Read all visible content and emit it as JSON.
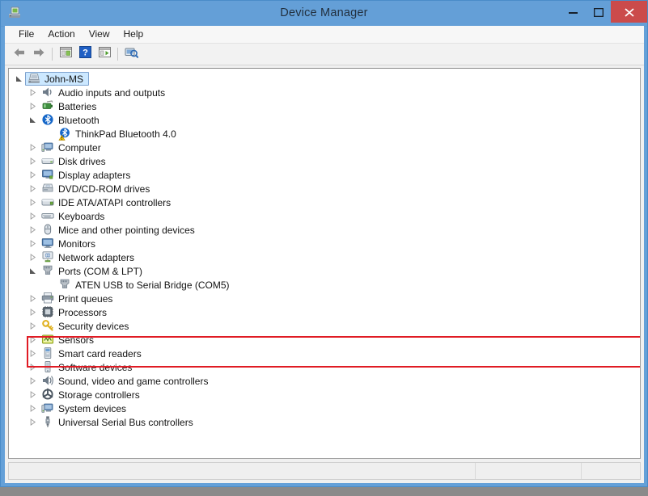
{
  "window": {
    "title": "Device Manager",
    "title_icon": "device-manager-icon",
    "controls": {
      "minimize": "minimize-button",
      "maximize": "maximize-button",
      "close": "close-button"
    },
    "accent_color": "#649fd7",
    "close_color": "#cb4b4b"
  },
  "menubar": {
    "items": [
      {
        "label": "File"
      },
      {
        "label": "Action"
      },
      {
        "label": "View"
      },
      {
        "label": "Help"
      }
    ]
  },
  "toolbar": {
    "buttons": [
      {
        "name": "back-icon",
        "type": "icon"
      },
      {
        "name": "forward-icon",
        "type": "icon"
      },
      {
        "name": "separator",
        "type": "separator"
      },
      {
        "name": "properties-icon",
        "type": "icon"
      },
      {
        "name": "help-icon",
        "type": "icon"
      },
      {
        "name": "update-driver-icon",
        "type": "icon"
      },
      {
        "name": "separator",
        "type": "separator"
      },
      {
        "name": "scan-hardware-changes-icon",
        "type": "icon"
      }
    ]
  },
  "tree": {
    "nodes": [
      {
        "label": "John-MS",
        "level": 0,
        "state": "expanded",
        "icon": "computer-root-icon",
        "selected": true
      },
      {
        "label": "Audio inputs and outputs",
        "level": 1,
        "state": "collapsed",
        "icon": "audio-icon"
      },
      {
        "label": "Batteries",
        "level": 1,
        "state": "collapsed",
        "icon": "battery-icon"
      },
      {
        "label": "Bluetooth",
        "level": 1,
        "state": "expanded",
        "icon": "bluetooth-icon"
      },
      {
        "label": "ThinkPad Bluetooth 4.0",
        "level": 2,
        "state": "leaf",
        "icon": "bluetooth-device-icon",
        "warning": true
      },
      {
        "label": "Computer",
        "level": 1,
        "state": "collapsed",
        "icon": "computer-icon"
      },
      {
        "label": "Disk drives",
        "level": 1,
        "state": "collapsed",
        "icon": "disk-drive-icon"
      },
      {
        "label": "Display adapters",
        "level": 1,
        "state": "collapsed",
        "icon": "display-adapter-icon"
      },
      {
        "label": "DVD/CD-ROM drives",
        "level": 1,
        "state": "collapsed",
        "icon": "dvd-drive-icon"
      },
      {
        "label": "IDE ATA/ATAPI controllers",
        "level": 1,
        "state": "collapsed",
        "icon": "ide-controller-icon"
      },
      {
        "label": "Keyboards",
        "level": 1,
        "state": "collapsed",
        "icon": "keyboard-icon"
      },
      {
        "label": "Mice and other pointing devices",
        "level": 1,
        "state": "collapsed",
        "icon": "mouse-icon"
      },
      {
        "label": "Monitors",
        "level": 1,
        "state": "collapsed",
        "icon": "monitor-icon"
      },
      {
        "label": "Network adapters",
        "level": 1,
        "state": "collapsed",
        "icon": "network-adapter-icon"
      },
      {
        "label": "Ports (COM & LPT)",
        "level": 1,
        "state": "expanded",
        "icon": "port-icon"
      },
      {
        "label": "ATEN USB to Serial Bridge (COM5)",
        "level": 2,
        "state": "leaf",
        "icon": "port-icon"
      },
      {
        "label": "Print queues",
        "level": 1,
        "state": "collapsed",
        "icon": "printer-icon"
      },
      {
        "label": "Processors",
        "level": 1,
        "state": "collapsed",
        "icon": "processor-icon"
      },
      {
        "label": "Security devices",
        "level": 1,
        "state": "collapsed",
        "icon": "security-key-icon"
      },
      {
        "label": "Sensors",
        "level": 1,
        "state": "collapsed",
        "icon": "sensor-icon"
      },
      {
        "label": "Smart card readers",
        "level": 1,
        "state": "collapsed",
        "icon": "smartcard-reader-icon"
      },
      {
        "label": "Software devices",
        "level": 1,
        "state": "collapsed",
        "icon": "software-device-icon"
      },
      {
        "label": "Sound, video and game controllers",
        "level": 1,
        "state": "collapsed",
        "icon": "sound-controller-icon"
      },
      {
        "label": "Storage controllers",
        "level": 1,
        "state": "collapsed",
        "icon": "storage-controller-icon"
      },
      {
        "label": "System devices",
        "level": 1,
        "state": "collapsed",
        "icon": "system-device-icon"
      },
      {
        "label": "Universal Serial Bus controllers",
        "level": 1,
        "state": "collapsed",
        "icon": "usb-controller-icon"
      }
    ]
  },
  "annotation": {
    "name": "red-highlight-box",
    "color": "#e01b24",
    "targets": [
      "Ports (COM & LPT)",
      "ATEN USB to Serial Bridge (COM5)"
    ]
  },
  "statusbar": {
    "text": "",
    "segment2": "",
    "segment3": ""
  }
}
